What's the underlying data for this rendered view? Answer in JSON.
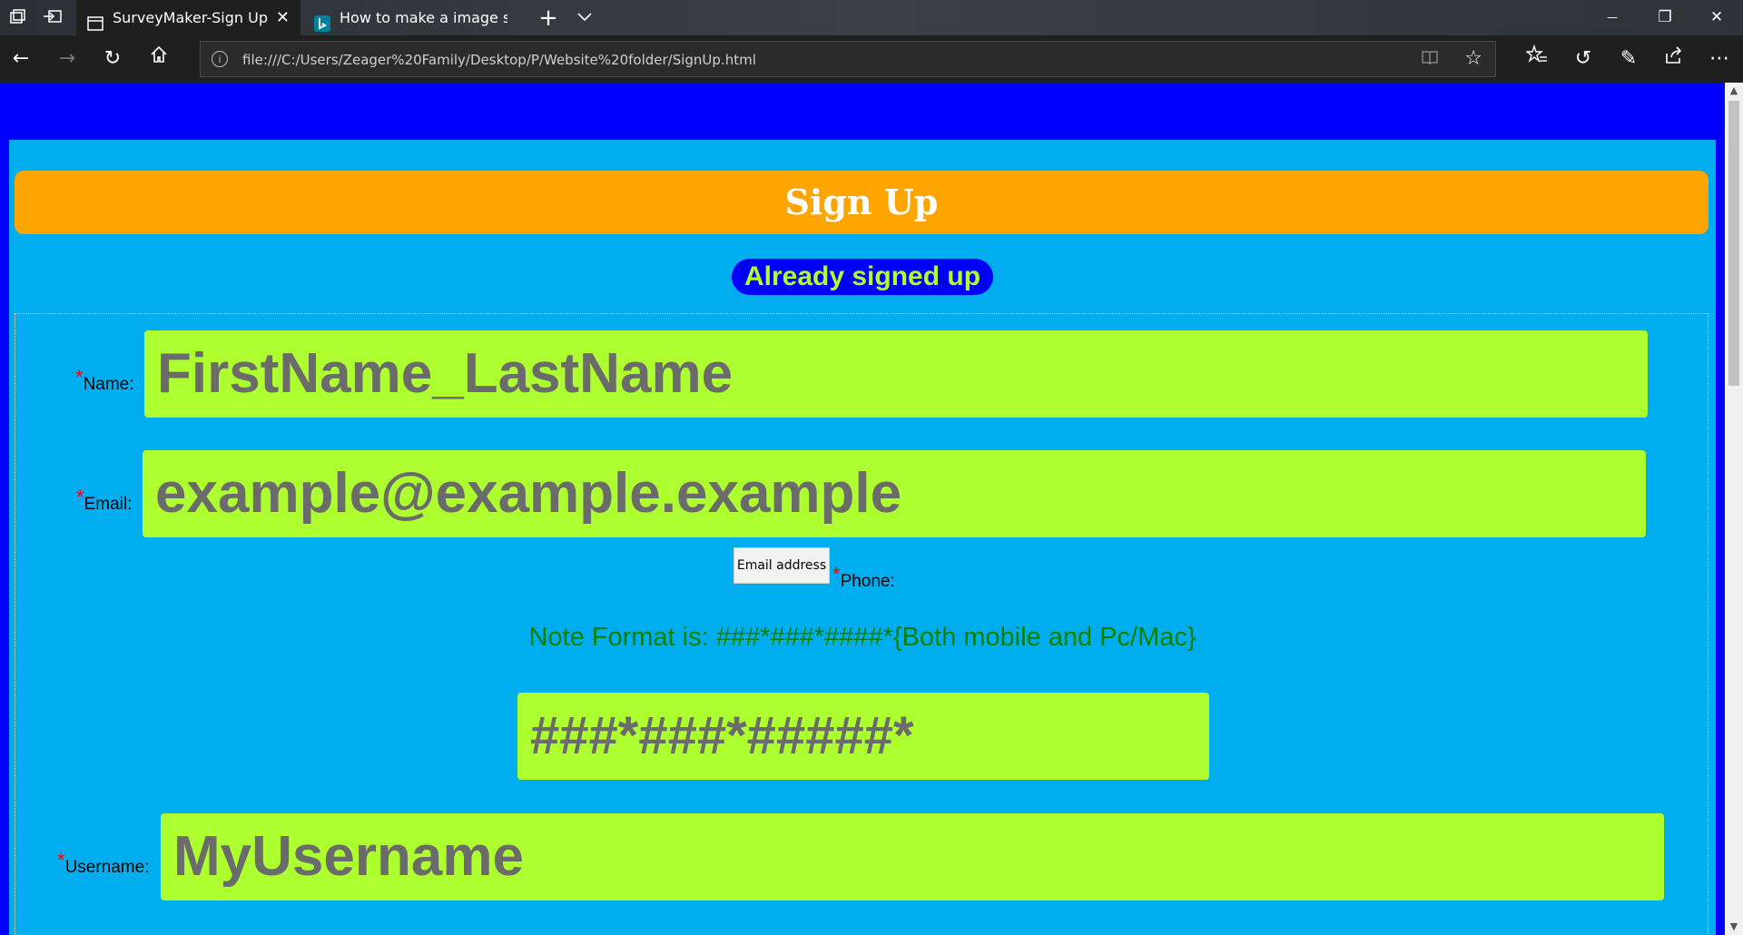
{
  "browser": {
    "tabs": [
      {
        "title": "SurveyMaker-Sign Up",
        "active": true
      },
      {
        "title": "How to make a image slides",
        "active": false
      }
    ],
    "address_url": "file:///C:/Users/Zeager%20Family/Desktop/P/Website%20folder/SignUp.html",
    "icons": {
      "tab_actions": "tab-actions-icon",
      "set_aside": "set-aside-tabs-icon",
      "new_tab": "+",
      "tab_list": "chevron-down-icon",
      "minimize": "—",
      "restore": "❐",
      "close": "✕",
      "back": "←",
      "forward": "→",
      "refresh": "↻",
      "home": "⌂",
      "info": "i",
      "reading_view": "📖",
      "favorite": "☆",
      "favorites_hub": "★≡",
      "history": "↺",
      "notes": "✎",
      "share": "⇪",
      "more": "⋯"
    }
  },
  "page": {
    "heading": "Sign Up",
    "already_link": "Already signed up",
    "fields": {
      "name": {
        "required_mark": "*",
        "label": "Name:",
        "value": "FirstName_LastName"
      },
      "email": {
        "required_mark": "*",
        "label": "Email:",
        "value": "example@example.example"
      },
      "phone": {
        "required_mark": "*",
        "label": "Phone:",
        "note": "Note Format is: ###*###*####*{Both mobile and Pc/Mac}",
        "value": "###*###*#####*"
      },
      "username": {
        "required_mark": "*",
        "label": "Username:",
        "value": "MyUsername"
      }
    },
    "tooltip": "Email address"
  },
  "colors": {
    "page_bg": "#0000ff",
    "panel_bg": "#00aeef",
    "banner_bg": "#ffa500",
    "field_bg": "#adff2f",
    "field_text": "#6b6b6b",
    "note_text": "#008000",
    "required": "#ff0000"
  }
}
